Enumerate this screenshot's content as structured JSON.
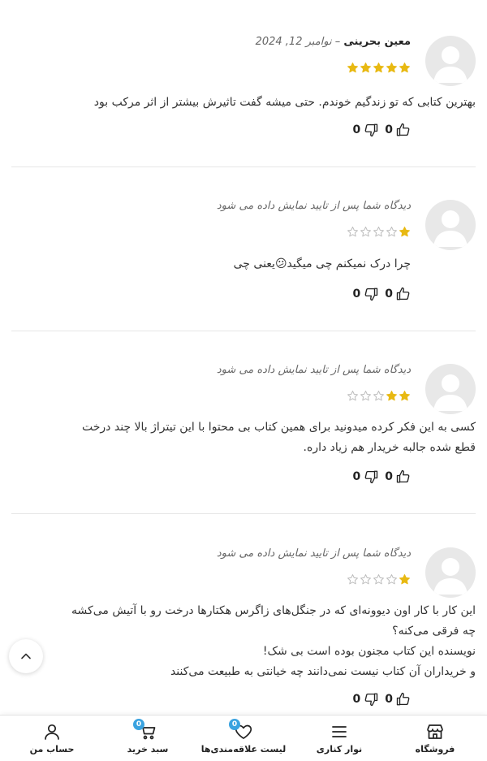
{
  "reviews": [
    {
      "author": "معین بحرینی",
      "date": "– نوامبر 12, 2024",
      "rating": 5,
      "text_lines": [
        "بهترین کتابی که تو زندگیم خوندم. حتی میشه گفت تاثیرش بیشتر از اثر مرکب بود"
      ],
      "likes": "0",
      "dislikes": "0"
    },
    {
      "pending": "دیدگاه شما پس از تایید نمایش داده می شود",
      "rating": 1,
      "text_lines": [
        "چرا درک نمیکنم چی میگید😕یعنی چی"
      ],
      "likes": "0",
      "dislikes": "0"
    },
    {
      "pending": "دیدگاه شما پس از تایید نمایش داده می شود",
      "rating": 2,
      "text_lines": [
        "کسی به این فکر کرده میدونید برای همین کتاب بی محتوا با این تیتراژ بالا چند درخت",
        "قطع شده جالبه خریدار هم زیاد داره."
      ],
      "likes": "0",
      "dislikes": "0"
    },
    {
      "pending": "دیدگاه شما پس از تایید نمایش داده می شود",
      "rating": 1,
      "text_lines": [
        "این کار با کار اون دیوونه‌ای که در جنگل‌های زاگرس هکتارها درخت رو با آتیش می‌کشه",
        "چه فرقی می‌کنه؟",
        "نویسنده این کتاب مجنون بوده است بی شک!",
        "و خریداران آن کتاب نیست نمی‌دانند چه خیانتی به طبیعت می‌کنند"
      ],
      "likes": "0",
      "dislikes": "0"
    }
  ],
  "colors": {
    "star_filled": "#e8b912",
    "star_empty": "#bdbdbd",
    "badge": "#3aa3e0"
  },
  "bottom_nav": {
    "shop": {
      "label": "فروشگاه",
      "icon": "store-icon"
    },
    "sidebar": {
      "label": "نوار کناری",
      "icon": "menu-icon"
    },
    "wishlist": {
      "label": "لیست علاقه‌مندی‌ها",
      "icon": "heart-icon",
      "badge": "0"
    },
    "cart": {
      "label": "سبد خرید",
      "icon": "cart-icon",
      "badge": "0"
    },
    "account": {
      "label": "حساب من",
      "icon": "user-icon"
    }
  }
}
